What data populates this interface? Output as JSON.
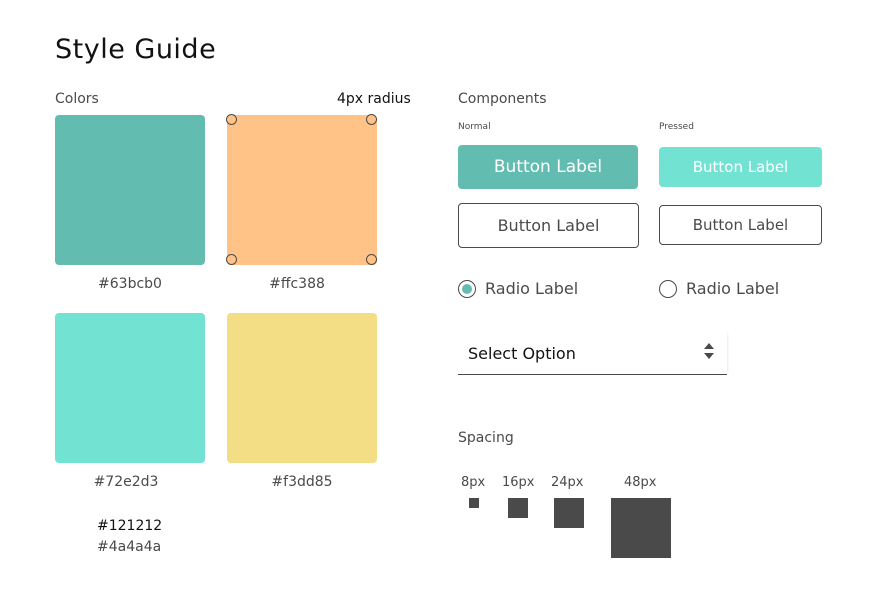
{
  "page": {
    "title": "Style Guide"
  },
  "colors": {
    "label": "Colors",
    "radius_label": "4px radius",
    "swatches": [
      {
        "hex": "#63bcb0"
      },
      {
        "hex": "#ffc388"
      },
      {
        "hex": "#72e2d3"
      },
      {
        "hex": "#f3dd85"
      }
    ],
    "text_colors": [
      {
        "hex": "#121212"
      },
      {
        "hex": "#4a4a4a"
      }
    ]
  },
  "components": {
    "label": "Components",
    "normal_label": "Normal",
    "pressed_label": "Pressed",
    "button_label": "Button Label",
    "radio_label": "Radio Label",
    "select_value": "Select Option"
  },
  "spacing": {
    "label": "Spacing",
    "sizes": [
      "8px",
      "16px",
      "24px",
      "48px"
    ]
  }
}
